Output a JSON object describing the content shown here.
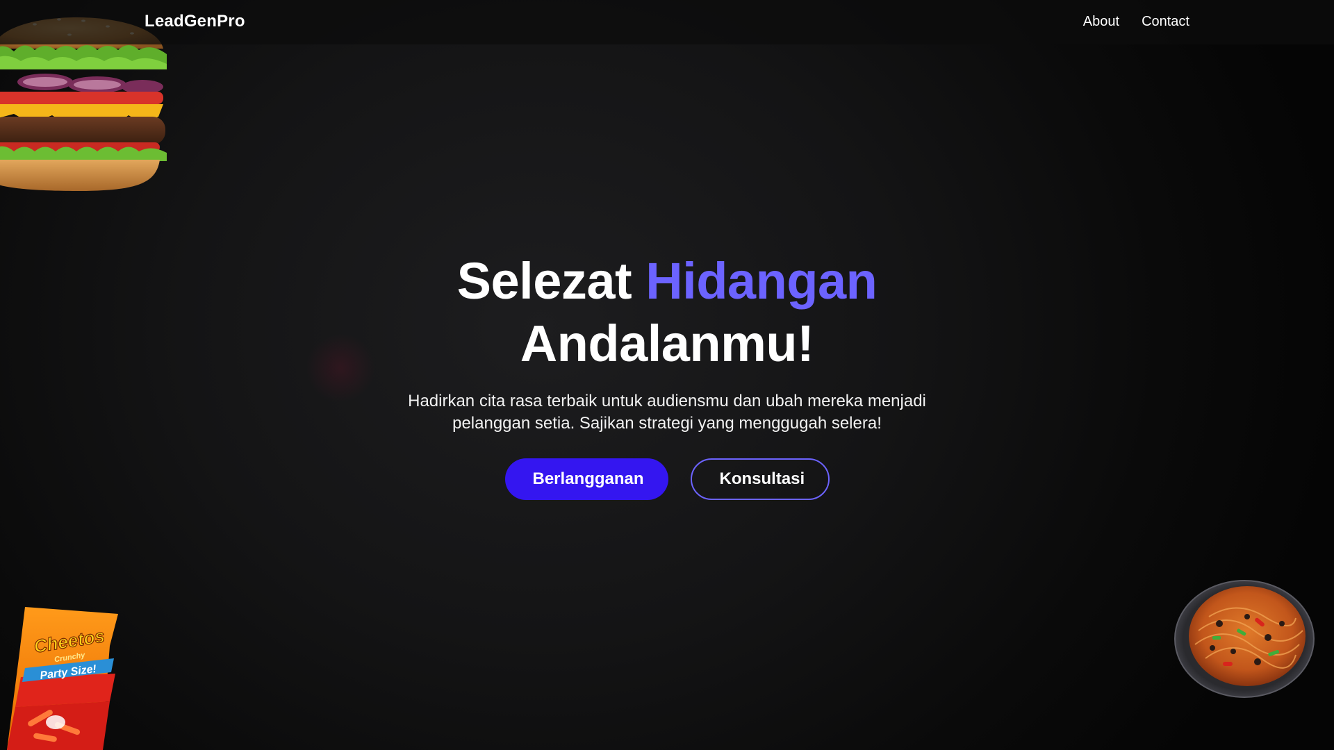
{
  "nav": {
    "brand": "LeadGenPro",
    "links": [
      "About",
      "Contact"
    ]
  },
  "hero": {
    "title_part1": "Selezat",
    "title_accent": "Hidangan",
    "title_line2": "Andalanmu!",
    "subtitle": "Hadirkan cita rasa terbaik untuk audiensmu dan ubah mereka menjadi pelanggan setia. Sajikan strategi yang menggugah selera!",
    "primary_button": "Berlangganan",
    "secondary_button": "Konsultasi"
  },
  "images": {
    "snack_bag_brand": "Cheetos",
    "snack_bag_variant": "Crunchy",
    "snack_bag_label": "Party Size!"
  },
  "colors": {
    "accent": "#6c63ff",
    "primary_button": "#3416f0",
    "background": "#0b0b0b"
  },
  "icons": [
    "burger-image",
    "snack-bag-image",
    "noodle-bowl-image"
  ]
}
